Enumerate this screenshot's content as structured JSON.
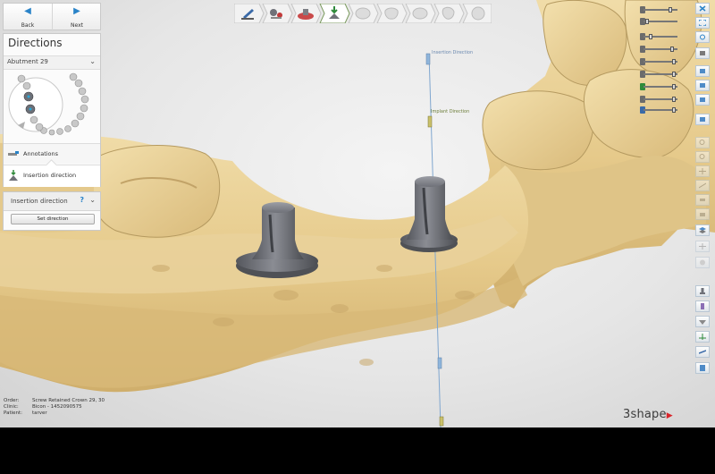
{
  "nav": {
    "back_label": "Back",
    "next_label": "Next",
    "back_arrow": "◀",
    "next_arrow": "▶"
  },
  "directions": {
    "title": "Directions",
    "abutment_selected": "Abutment 29",
    "items": [
      {
        "label": "Annotations",
        "icon": "annotations-icon"
      },
      {
        "label": "Insertion direction",
        "icon": "insertion-direction-icon"
      }
    ]
  },
  "insertion_panel": {
    "title": "Insertion direction",
    "help_symbol": "?",
    "set_direction_label": "Set direction"
  },
  "top_toolbar": {
    "steps": [
      {
        "icon": "margin-line-icon",
        "active": false
      },
      {
        "icon": "abutment-design-icon",
        "active": false
      },
      {
        "icon": "gingiva-icon",
        "active": false
      },
      {
        "icon": "insertion-direction-icon",
        "active": true
      },
      {
        "icon": "crown-icon",
        "active": false
      },
      {
        "icon": "tooth-icon",
        "active": false
      },
      {
        "icon": "crown-top-icon",
        "active": false
      },
      {
        "icon": "tooth-side-icon",
        "active": false
      },
      {
        "icon": "finish-icon",
        "active": false
      }
    ]
  },
  "scene": {
    "insertion_direction_label": "Insertion Direction",
    "implant_direction_label": "Implant Direction"
  },
  "info": {
    "order_key": "Order:",
    "order_value": "Screw Retained Crown 29, 30",
    "clinic_key": "Clinic:",
    "clinic_value": "Bicon - 1452090575",
    "patient_key": "Patient:",
    "patient_value": "tarver"
  },
  "logo": {
    "text": "3shape",
    "mark": "▶"
  },
  "colors": {
    "model": "#e8cf94",
    "model_shadow": "#b99e63",
    "abutment": "#6f7178",
    "accent": "#2a83c8",
    "logo_mark": "#d9242a"
  }
}
